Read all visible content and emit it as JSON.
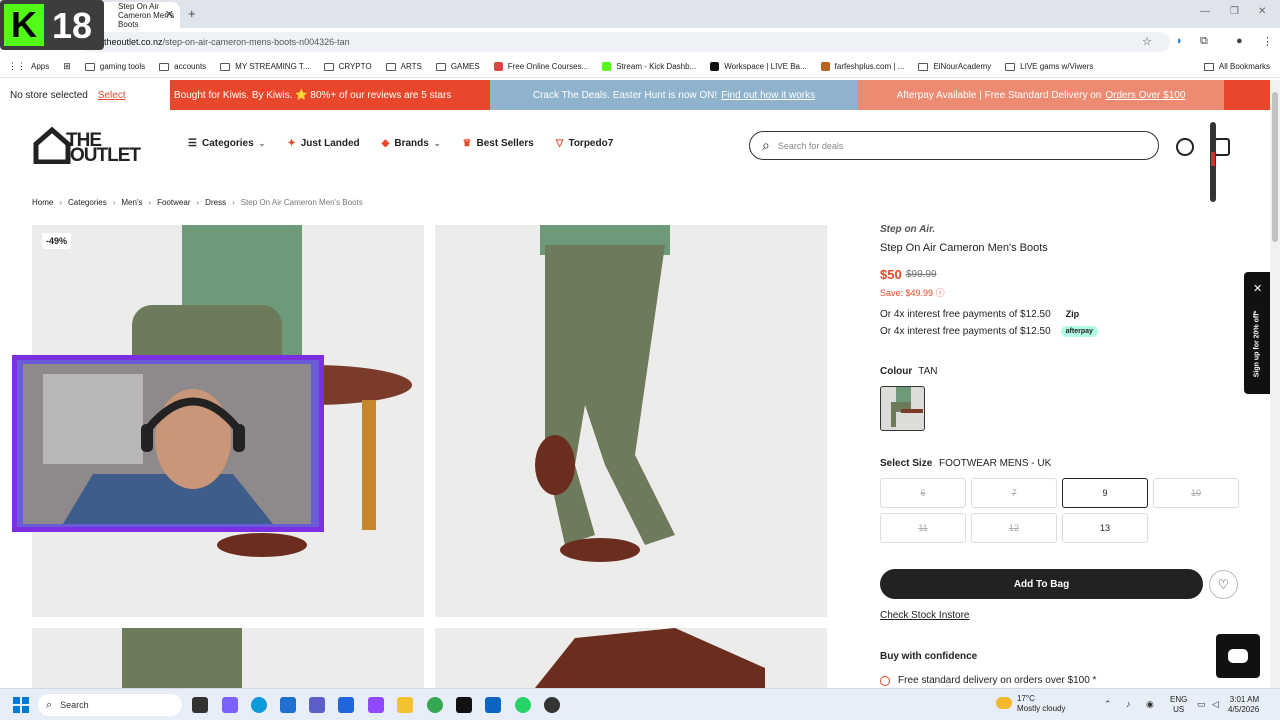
{
  "browser": {
    "tab_title": "Step On Air Cameron Men's Boots",
    "url_host": "theoutlet.co.nz",
    "url_path": "/step-on-air-cameron-mens-boots-n004326-tan",
    "bookmarks": [
      "Apps",
      "gaming tools",
      "accounts",
      "MY STREAMING T...",
      "CRYPTO",
      "ARTS",
      "GAMES",
      "Free Online Courses...",
      "Stream - Kick Dashb...",
      "Workspace | LIVE Ba...",
      "farfeshplus.com | ...",
      "ElNourAcademy",
      "LIVE gams w/Viwers"
    ],
    "all_bookmarks": "All Bookmarks"
  },
  "promo": {
    "store_text": "No store selected",
    "store_link": "Select",
    "p1": "Bought for Kiwis. By Kiwis. ⭐ 80%+ of our reviews are 5 stars",
    "p2_text": "Crack The Deals. Easter Hunt is now ON!",
    "p2_link": "Find out how it works",
    "p3_text": "Afterpay Available | Free Standard Delivery on",
    "p3_link": "Orders Over $100"
  },
  "header": {
    "logo_line1": "THE",
    "logo_line2": "OUTLET",
    "nav": [
      "Categories",
      "Just Landed",
      "Brands",
      "Best Sellers",
      "Torpedo7"
    ],
    "search_placeholder": "Search for deals"
  },
  "breadcrumb": [
    "Home",
    "Categories",
    "Men's",
    "Footwear",
    "Dress",
    "Step On Air Cameron Men's Boots"
  ],
  "product": {
    "discount_badge": "-49%",
    "brand": "Step on Air.",
    "name": "Step On Air Cameron Men's Boots",
    "price": "$50",
    "old_price": "$99.99",
    "save": "Save: $49.99",
    "pay1": "Or 4x interest free payments of $12.50",
    "pay1_badge": "Zip",
    "pay2": "Or 4x interest free payments of $12.50",
    "pay2_badge": "afterpay",
    "colour_label": "Colour",
    "colour_value": "TAN",
    "size_label": "Select Size",
    "size_system": "FOOTWEAR MENS - UK",
    "sizes": [
      {
        "label": "6",
        "available": false
      },
      {
        "label": "7",
        "available": false
      },
      {
        "label": "9",
        "available": true,
        "selected": true
      },
      {
        "label": "10",
        "available": false
      },
      {
        "label": "11",
        "available": false
      },
      {
        "label": "12",
        "available": false
      },
      {
        "label": "13",
        "available": true
      }
    ],
    "add_to_bag": "Add To Bag",
    "check_stock": "Check Stock Instore",
    "confidence_title": "Buy with confidence",
    "delivery_text": "Free standard delivery on orders over $100 *"
  },
  "signup_tab": "Sign up for 20% off*",
  "overlay": {
    "kick_letter": "K",
    "age": "18"
  },
  "taskbar": {
    "search_placeholder": "Search",
    "weather_temp": "17°C",
    "weather_desc": "Mostly cloudy",
    "lang1": "ENG",
    "lang2": "US",
    "time": "3:01 AM",
    "date": "4/5/2026"
  },
  "colors": {
    "accent": "#e8472b",
    "promo_blue": "#8fb3cc",
    "promo_peach": "#ec8a72",
    "kick_green": "#53fc18",
    "cam_frame": "#7b2fe0"
  }
}
